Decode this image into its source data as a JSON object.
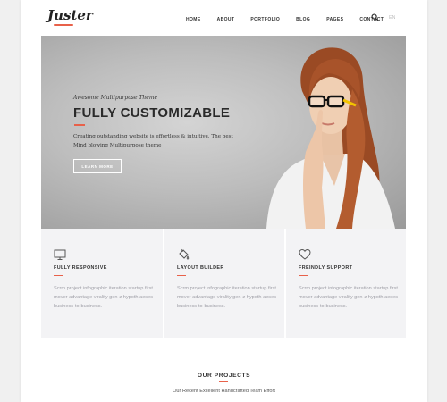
{
  "header": {
    "logo": "Juster",
    "nav": [
      "HOME",
      "ABOUT",
      "PORTFOLIO",
      "BLOG",
      "PAGES",
      "CONTACT"
    ],
    "lang": "EN"
  },
  "hero": {
    "subtitle": "Awesome Multipurpose Theme",
    "title": "FULLY CUSTOMIZABLE",
    "description": "Creating outstanding website is effortless & intuitive. The best Mind blowing Multipurpose theme",
    "button": "LEARN MORE"
  },
  "features": [
    {
      "icon": "monitor-icon",
      "title": "FULLY RESPONSIVE",
      "text": "Scrm project infographic iteration startup first mover advantage virality gen-z hypoth aeses business-to-business."
    },
    {
      "icon": "paint-bucket-icon",
      "title": "LAYOUT BUILDER",
      "text": "Scrm project infographic iteration startup first mover advantage virality gen-z hypoth aeses business-to-business."
    },
    {
      "icon": "heart-icon",
      "title": "FREINDLY SUPPORT",
      "text": "Scrm project infographic iteration startup first mover advantage virality gen-z hypoth aeses business-to-business."
    }
  ],
  "projects": {
    "title": "OUR PROJECTS",
    "subtitle": "Our Recent Excellent Handcrafted Team Effort"
  },
  "colors": {
    "accent": "#e8614a",
    "feature_bg": "#f3f3f5",
    "muted_text": "#a0a0a8"
  }
}
